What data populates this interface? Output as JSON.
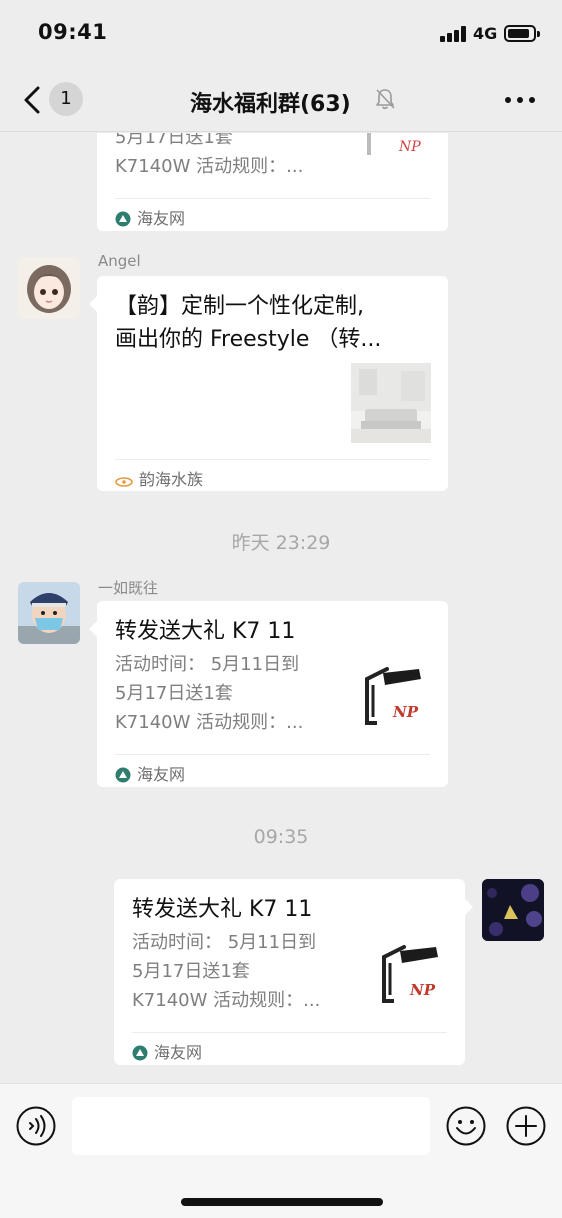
{
  "status_bar": {
    "time": "09:41",
    "network": "4G"
  },
  "nav": {
    "back_badge": "1",
    "title": "海水福利群(63)"
  },
  "messages": [
    {
      "kind": "link_card_partial",
      "desc_lines": [
        "5月17日送1套",
        "K7140W 活动规则：..."
      ],
      "source": "海友网"
    },
    {
      "kind": "link_card",
      "sender": "Angel",
      "title_lines": [
        "【韵】定制一个性化定制,",
        "画出你的 Freestyle （转..."
      ],
      "source": "韵海水族"
    },
    {
      "kind": "time",
      "text": "昨天 23:29"
    },
    {
      "kind": "link_card",
      "sender": "一如既往",
      "title": "转发送大礼 K7 11",
      "desc_lines": [
        "活动时间：  5月11日到",
        "5月17日送1套",
        "K7140W 活动规则：..."
      ],
      "source": "海友网"
    },
    {
      "kind": "time",
      "text": "09:35"
    },
    {
      "kind": "link_card_self",
      "title": "转发送大礼 K7 11",
      "desc_lines": [
        "活动时间：  5月11日到",
        "5月17日送1套",
        "K7140W 活动规则：..."
      ],
      "source": "海友网"
    }
  ],
  "input_bar": {
    "placeholder": ""
  },
  "colors": {
    "background": "#ededed",
    "card": "#ffffff",
    "source_icon": "#2f7d6e",
    "time_text": "#a7a7a7"
  }
}
